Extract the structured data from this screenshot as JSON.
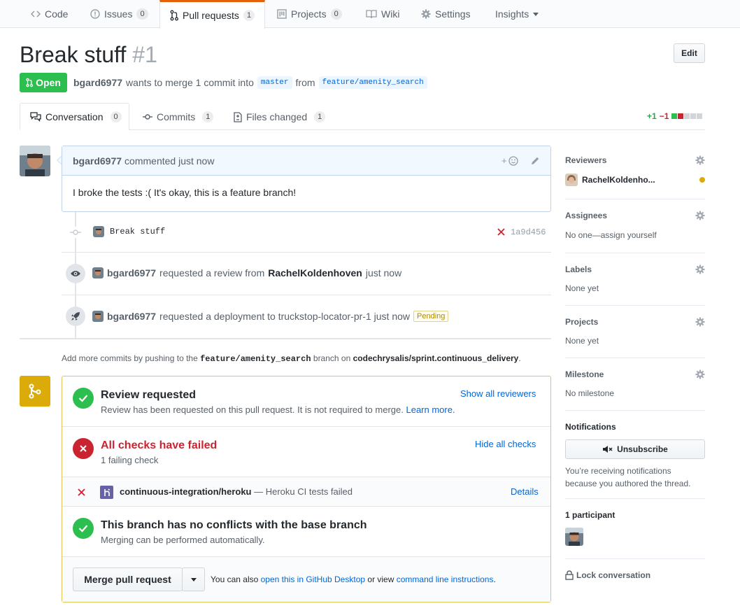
{
  "nav": {
    "code": "Code",
    "issues": "Issues",
    "issues_count": "0",
    "pulls": "Pull requests",
    "pulls_count": "1",
    "projects": "Projects",
    "projects_count": "0",
    "wiki": "Wiki",
    "settings": "Settings",
    "insights": "Insights"
  },
  "pr": {
    "title": "Break stuff",
    "number": "#1",
    "edit": "Edit",
    "state": "Open",
    "author": "bgard6977",
    "merge_text": "wants to merge 1 commit into",
    "base": "master",
    "from": "from",
    "head": "feature/amenity_search"
  },
  "tabs": {
    "conversation": "Conversation",
    "conversation_count": "0",
    "commits": "Commits",
    "commits_count": "1",
    "files": "Files changed",
    "files_count": "1",
    "additions": "+1",
    "deletions": "−1"
  },
  "comment": {
    "author": "bgard6977",
    "action": "commented just now",
    "body": "I broke the tests :( It's okay, this is a feature branch!"
  },
  "commit": {
    "message": "Break stuff",
    "sha": "1a9d456"
  },
  "events": {
    "review_user": "bgard6977",
    "review_text": "requested a review from",
    "review_target": "RachelKoldenhoven",
    "review_time": "just now",
    "deploy_user": "bgard6977",
    "deploy_text": "requested a deployment to truckstop-locator-pr-1 just now",
    "deploy_status": "Pending"
  },
  "push_hint": {
    "pre": "Add more commits by pushing to the",
    "branch": "feature/amenity_search",
    "mid": "branch on",
    "repo": "codechrysalis/sprint.continuous_delivery",
    "end": "."
  },
  "merge": {
    "review_title": "Review requested",
    "review_sub": "Review has been requested on this pull request. It is not required to merge.",
    "learn_more": "Learn more.",
    "show_reviewers": "Show all reviewers",
    "checks_title": "All checks have failed",
    "checks_sub": "1 failing check",
    "hide_checks": "Hide all checks",
    "check_name": "continuous-integration/heroku",
    "check_desc": "— Heroku CI tests failed",
    "details": "Details",
    "conflict_title": "This branch has no conflicts with the base branch",
    "conflict_sub": "Merging can be performed automatically.",
    "merge_button": "Merge pull request",
    "also_pre": "You can also",
    "desktop_link": "open this in GitHub Desktop",
    "also_mid": "or view",
    "cli_link": "command line instructions",
    "also_end": "."
  },
  "sidebar": {
    "reviewers": "Reviewers",
    "reviewer_name": "RachelKoldenho...",
    "assignees": "Assignees",
    "assignees_value": "No one—assign yourself",
    "labels": "Labels",
    "labels_value": "None yet",
    "projects": "Projects",
    "projects_value": "None yet",
    "milestone": "Milestone",
    "milestone_value": "No milestone",
    "notifications": "Notifications",
    "unsubscribe": "Unsubscribe",
    "notif_reason_1": "You’re receiving notifications",
    "notif_reason_2": "because you authored the thread.",
    "participants": "1 participant",
    "lock": "Lock conversation"
  },
  "colors": {
    "accent_orange": "#e36209",
    "open_green": "#2cbe4e",
    "fail_red": "#cb2431",
    "link_blue": "#0366d6",
    "merge_yellow": "#dbab09"
  }
}
